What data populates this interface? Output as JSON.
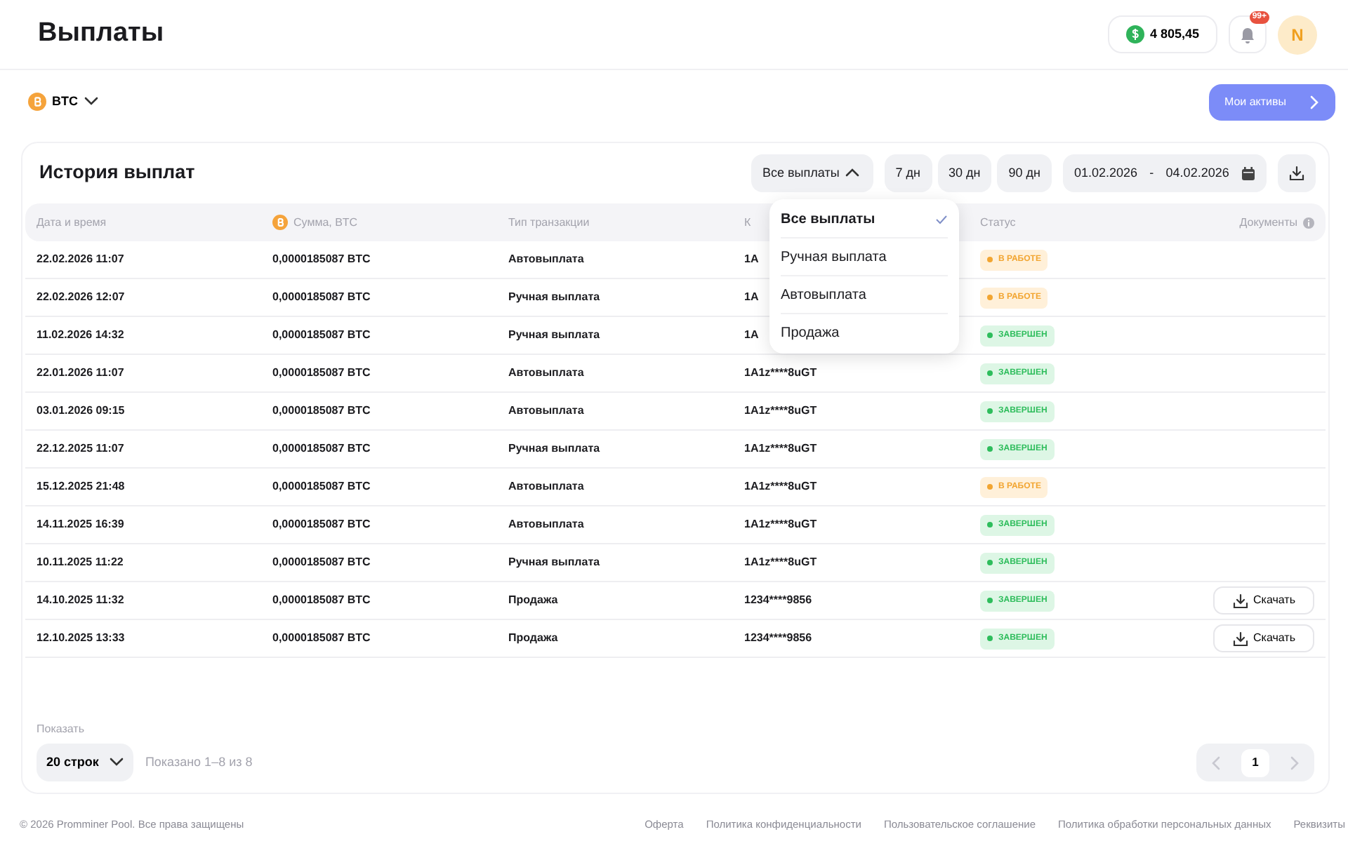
{
  "header": {
    "title": "Выплаты",
    "balance": "4 805,45",
    "notifications_badge": "99+",
    "avatar": "N"
  },
  "currency": {
    "label": "BTC",
    "expanded": false
  },
  "assets_button": "Мои активы",
  "history": {
    "title": "История выплат",
    "filter": {
      "label": "Все выплаты",
      "expanded": true,
      "options": [
        {
          "label": "Все выплаты",
          "selected": true
        },
        {
          "label": "Ручная выплата",
          "selected": false
        },
        {
          "label": "Автовыплата",
          "selected": false
        },
        {
          "label": "Продажа",
          "selected": false
        }
      ]
    },
    "periods": [
      {
        "label": "7 дн",
        "selected": false
      },
      {
        "label": "30 дн",
        "selected": false
      },
      {
        "label": "90 дн",
        "selected": false
      }
    ],
    "date_from": "01.02.2026",
    "date_separator": "-",
    "date_to": "04.02.2026",
    "columns": [
      "Дата и время",
      "Сумма, BTC",
      "Тип транзакции",
      "К",
      "Статус",
      "Документы"
    ],
    "rows": [
      {
        "date": "22.02.2026 11:07",
        "amount": "0,0000185087 BTC",
        "type": "Автовыплата",
        "address": "1A",
        "status": {
          "kind": "work",
          "label": "В РАБОТЕ"
        }
      },
      {
        "date": "22.02.2026 12:07",
        "amount": "0,0000185087 BTC",
        "type": "Ручная выплата",
        "address": "1A",
        "status": {
          "kind": "work",
          "label": "В РАБОТЕ"
        }
      },
      {
        "date": "11.02.2026 14:32",
        "amount": "0,0000185087 BTC",
        "type": "Ручная выплата",
        "address": "1A",
        "status": {
          "kind": "done",
          "label": "ЗАВЕРШЕН"
        }
      },
      {
        "date": "22.01.2026 11:07",
        "amount": "0,0000185087 BTC",
        "type": "Автовыплата",
        "address": "1A1z****8uGT",
        "status": {
          "kind": "done",
          "label": "ЗАВЕРШЕН"
        }
      },
      {
        "date": "03.01.2026 09:15",
        "amount": "0,0000185087 BTC",
        "type": "Автовыплата",
        "address": "1A1z****8uGT",
        "status": {
          "kind": "done",
          "label": "ЗАВЕРШЕН"
        }
      },
      {
        "date": "22.12.2025 11:07",
        "amount": "0,0000185087 BTC",
        "type": "Ручная выплата",
        "address": "1A1z****8uGT",
        "status": {
          "kind": "done",
          "label": "ЗАВЕРШЕН"
        }
      },
      {
        "date": "15.12.2025 21:48",
        "amount": "0,0000185087 BTC",
        "type": "Автовыплата",
        "address": "1A1z****8uGT",
        "status": {
          "kind": "work",
          "label": "В РАБОТЕ"
        }
      },
      {
        "date": "14.11.2025 16:39",
        "amount": "0,0000185087 BTC",
        "type": "Автовыплата",
        "address": "1A1z****8uGT",
        "status": {
          "kind": "done",
          "label": "ЗАВЕРШЕН"
        }
      },
      {
        "date": "10.11.2025 11:22",
        "amount": "0,0000185087 BTC",
        "type": "Ручная выплата",
        "address": "1A1z****8uGT",
        "status": {
          "kind": "done",
          "label": "ЗАВЕРШЕН"
        }
      },
      {
        "date": "14.10.2025 11:32",
        "amount": "0,0000185087 BTC",
        "type": "Продажа",
        "address": "1234****9856",
        "status": {
          "kind": "done",
          "label": "ЗАВЕРШЕН"
        },
        "document": "Скачать"
      },
      {
        "date": "12.10.2025 13:33",
        "amount": "0,0000185087 BTC",
        "type": "Продажа",
        "address": "1234****9856",
        "status": {
          "kind": "done",
          "label": "ЗАВЕРШЕН"
        },
        "document": "Скачать"
      }
    ]
  },
  "pager": {
    "show_label": "Показать",
    "page_size": "20 строк",
    "summary": "Показано 1–8 из 8",
    "pages": [
      {
        "label": "1",
        "selected": true
      }
    ]
  },
  "footer": {
    "copyright": "© 2026 Promminer Pool. Все права защищены",
    "links": [
      "Оферта",
      "Политика конфиденциальности",
      "Пользовательское соглашение",
      "Политика обработки персональных данных",
      "Реквизиты"
    ]
  }
}
